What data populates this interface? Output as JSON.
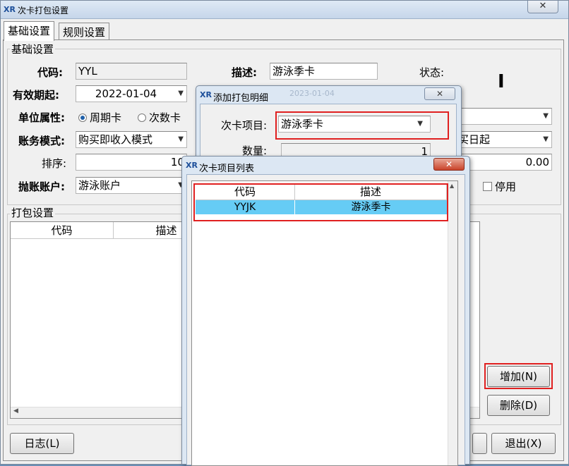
{
  "main_window": {
    "title": "次卡打包设置",
    "logo": "XR",
    "close_glyph": "✕",
    "tabs": [
      {
        "label": "基础设置",
        "active": true
      },
      {
        "label": "规则设置",
        "active": false
      }
    ]
  },
  "basic_settings": {
    "group_title": "基础设置",
    "code_label": "代码:",
    "code_value": "YYL",
    "desc_label": "描述:",
    "desc_value": "游泳季卡",
    "status_label": "状态:",
    "status_value": "I",
    "valid_from_label": "有效期起:",
    "valid_from_value": "2022-01-04",
    "unit_attr_label": "单位属性:",
    "unit_options": [
      "周期卡",
      "次数卡"
    ],
    "unit_selected": "周期卡",
    "account_mode_label": "账务模式:",
    "account_mode_value": "购买即收入模式",
    "right_combo2_value": "买日起",
    "sort_label": "排序:",
    "sort_value": "10",
    "amount_value": "0.00",
    "account_label": "抛账账户:",
    "account_value": "游泳账户",
    "disable_label": "停用"
  },
  "pack_settings": {
    "group_title": "打包设置",
    "columns": [
      "代码",
      "描述"
    ],
    "add_button": "增加(N)",
    "delete_button": "删除(D)"
  },
  "footer": {
    "log_button": "日志(L)",
    "exit_button": "退出(X)"
  },
  "dialog_add": {
    "title": "添加打包明细",
    "logo": "XR",
    "close_glyph": "✕",
    "item_label": "次卡项目:",
    "item_value": "游泳季卡",
    "qty_label": "数量:",
    "qty_value": "1",
    "hidden_date": "2023-01-04"
  },
  "dialog_list": {
    "title": "次卡项目列表",
    "logo": "XR",
    "close_glyph": "✕",
    "columns": [
      "代码",
      "描述"
    ],
    "rows": [
      {
        "code": "YYJK",
        "desc": "游泳季卡",
        "selected": true
      }
    ]
  },
  "colors": {
    "highlight_box": "#e02020",
    "selected_row": "#66ccf5"
  }
}
